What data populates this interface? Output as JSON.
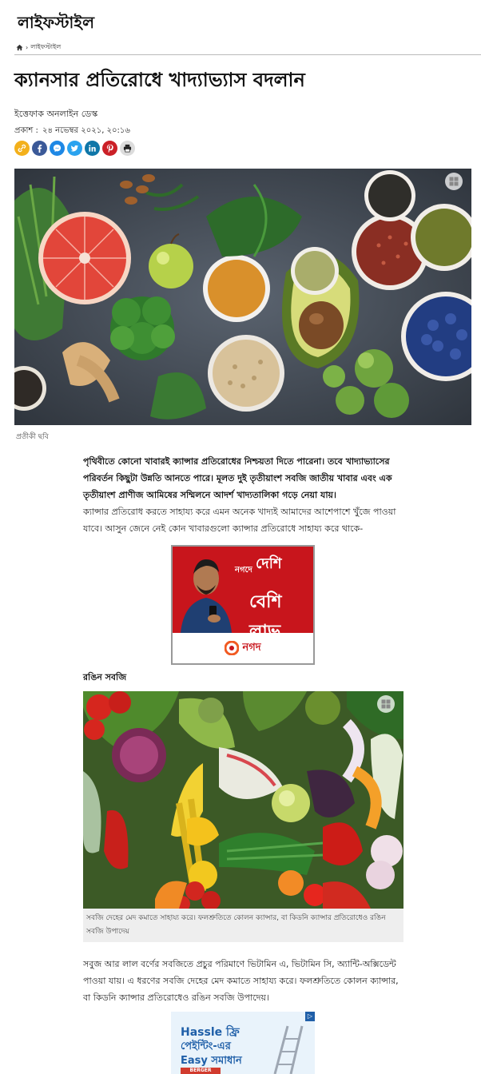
{
  "header": {
    "section_title": "লাইফস্টাইল"
  },
  "breadcrumb": {
    "current": "লাইফস্টাইল",
    "separator": "›"
  },
  "article": {
    "headline": "ক্যানসার প্রতিরোধে খাদ্যাভ্যাস বদলান",
    "author": "ইত্তেফাক অনলাইন ডেস্ক",
    "published_label": "প্রকাশ :",
    "published_date": "২৪ নভেম্বর ২০২১, ২০:১৬",
    "hero_caption": "প্রতীকী ছবি",
    "lead": "পৃথিবীতে কোনো খাবারই ক্যান্সার প্রতিরোধের নিশ্চয়তা দিতে পারেনা। তবে খাদ্যাভ্যাসের পরিবর্তন কিছুটা উন্নতি আনতে পারে। মূলত দুই তৃতীয়াংশ সবজি জাতীয় খাবার এবং এক তৃতীয়াংশ প্রাণীজ আমিষের সম্মিলনে আদর্শ খাদ্যতালিকা গড়ে নেয়া যায়।",
    "paragraph1": "ক্যান্সার প্রতিরোধ করতে সাহায্য করে এমন অনেক খাদ্যই আমাদের আশেপাশে খুঁজে পাওয়া যাবে। আসুন জেনে নেই কোন খাবারগুলো ক্যান্সার প্রতিরোধে সাহায্য করে থাকে-",
    "subheading": "রঙিন সবজি",
    "veg_caption": "সবজি দেহের মেদ কমাতে সাহায্য করে। ফলশ্রুতিতে কোলন ক্যান্সার, বা কিডনি ক্যান্সার প্রতিরোধেও রঙিন সবজি উপাদেয়",
    "paragraph2": "সবুজ আর লাল বর্ণের সবজিতে প্রচুর পরিমাণে ভিটামিন এ, ভিটামিন সি, অ্যান্টি-অক্সিডেন্ট পাওয়া যায়। এ ধরণের সবজি দেহের মেদ কমাতে সাহায্য করে। ফলশ্রুতিতে কোলন ক্যান্সার, বা কিডনি ক্যান্সার প্রতিরোধেও রঙিন সবজি উপাদেয়।"
  },
  "share": [
    {
      "name": "copy-link",
      "icon": "link-icon",
      "color": "#f3b01b"
    },
    {
      "name": "facebook",
      "icon": "facebook-icon",
      "color": "#3b5998"
    },
    {
      "name": "messenger",
      "icon": "messenger-icon",
      "color": "#1e88e5"
    },
    {
      "name": "twitter",
      "icon": "twitter-icon",
      "color": "#2aa3ef"
    },
    {
      "name": "linkedin",
      "icon": "linkedin-icon",
      "color": "#0e76a8"
    },
    {
      "name": "pinterest",
      "icon": "pinterest-icon",
      "color": "#cb2027"
    },
    {
      "name": "print",
      "icon": "print-icon",
      "color": "#dcdcdc"
    }
  ],
  "ad1": {
    "line1": "দেশি",
    "line2": "নগদে",
    "line3": "বেশি লাভ",
    "brand": "নগদ",
    "color": "#c8151c"
  },
  "ad2": {
    "line1": "Hassle ফ্রি",
    "line2": "পেইন্টিং-এর",
    "line3": "Easy সমাধান",
    "brand": "BERGER"
  }
}
